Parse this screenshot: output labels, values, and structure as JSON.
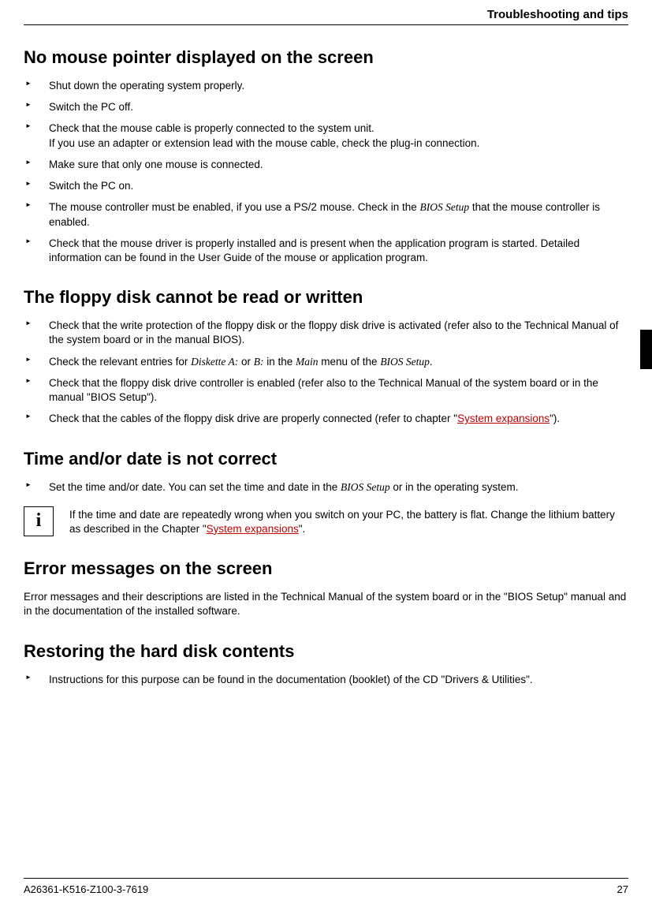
{
  "header": {
    "title": "Troubleshooting and tips"
  },
  "sections": {
    "s1": {
      "heading": "No mouse pointer displayed on the screen",
      "items": {
        "i0": "Shut down the operating system properly.",
        "i1": "Switch the PC off.",
        "i2a": "Check that the mouse cable is properly connected to the system unit.",
        "i2b": "If you use an adapter or extension lead with the mouse cable, check the plug-in connection.",
        "i3": "Make sure that only one mouse is connected.",
        "i4": "Switch the PC on.",
        "i5a": "The mouse controller must be enabled, if you use a PS/2 mouse. Check in the ",
        "i5b": "BIOS Setup",
        "i5c": " that the mouse controller is enabled.",
        "i6": "Check that the mouse driver is properly installed and is present when the application program is started. Detailed information can be found in the User Guide of the mouse or application program."
      }
    },
    "s2": {
      "heading": "The floppy disk cannot be read or written",
      "items": {
        "i0": "Check that the write protection of the floppy disk or the floppy disk drive is activated (refer also to the Technical Manual of the system board or in the manual BIOS).",
        "i1a": "Check the relevant entries for ",
        "i1b": "Diskette A:",
        "i1c": " or ",
        "i1d": "B:",
        "i1e": " in the ",
        "i1f": "Main",
        "i1g": " menu of the ",
        "i1h": "BIOS Setup",
        "i1i": ".",
        "i2": "Check that the floppy disk drive controller is enabled (refer also to the Technical Manual of the system board or in the manual \"BIOS Setup\").",
        "i3a": "Check that the cables of the floppy disk drive are properly connected (refer to chapter \"",
        "i3b": "System expansions",
        "i3c": "\")."
      }
    },
    "s3": {
      "heading": "Time and/or date is not correct",
      "items": {
        "i0a": "Set the time and/or date. You can set the time and date in the ",
        "i0b": "BIOS Setup",
        "i0c": " or in the operating system."
      },
      "info": {
        "icon": "i",
        "text_a": "If the time and date are repeatedly wrong when you switch on your PC, the battery is flat. Change the lithium battery as described in the Chapter \"",
        "text_b": "System expansions",
        "text_c": "\"."
      }
    },
    "s4": {
      "heading": "Error messages on the screen",
      "paragraph": "Error messages and their descriptions are listed in the Technical Manual of the system board or in the \"BIOS Setup\" manual and in the documentation of the installed software."
    },
    "s5": {
      "heading": "Restoring the hard disk contents",
      "items": {
        "i0": "Instructions for this purpose can be found in the documentation (booklet) of the CD \"Drivers & Utilities\"."
      }
    }
  },
  "footer": {
    "doc_id": "A26361-K516-Z100-3-7619",
    "page_num": "27"
  }
}
